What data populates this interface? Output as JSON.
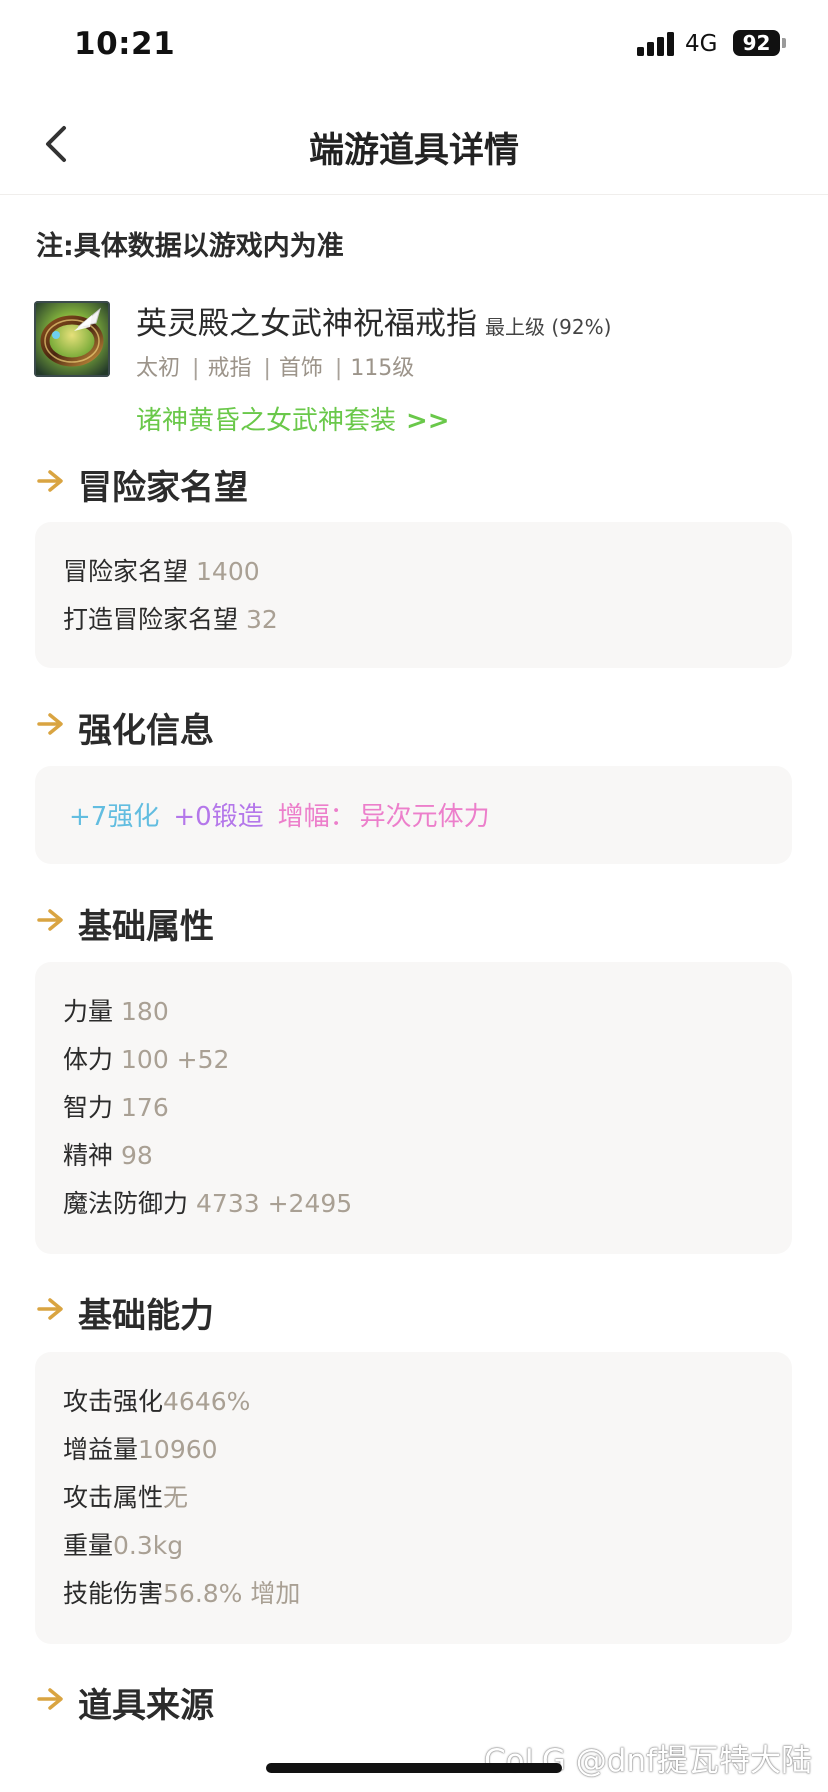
{
  "status_bar": {
    "time": "10:21",
    "network": "4G",
    "battery": "92"
  },
  "nav": {
    "title": "端游道具详情",
    "back_icon": "chevron-left-icon"
  },
  "note": "注:具体数据以游戏内为准",
  "item": {
    "name": "英灵殿之女武神祝福戒指",
    "grade": "最上级 (92%)",
    "rarity": "太初",
    "slot": "戒指",
    "category": "首饰",
    "level": "115级",
    "set_name": "诸神黄昏之女武神套装",
    "set_arrow": ">>",
    "icon": "ring-icon"
  },
  "sections": {
    "fame": {
      "title": "冒险家名望",
      "rows": [
        {
          "label": "冒险家名望",
          "value": "1400"
        },
        {
          "label": "打造冒险家名望",
          "value": "32"
        }
      ]
    },
    "enhance": {
      "title": "强化信息",
      "reinforce": "+7强化",
      "forge": "+0锻造",
      "amplify_label": "增幅：",
      "amplify_value": "异次元体力",
      "colors": {
        "reinforce": "#62bde0",
        "forge": "#b477ea",
        "amplify": "#ec7fcb"
      }
    },
    "base_attrs": {
      "title": "基础属性",
      "rows": [
        {
          "label": "力量",
          "value": "180"
        },
        {
          "label": "体力",
          "value": "100 +52"
        },
        {
          "label": "智力",
          "value": "176"
        },
        {
          "label": "精神",
          "value": "98"
        },
        {
          "label": "魔法防御力",
          "value": "4733 +2495"
        }
      ]
    },
    "base_abilities": {
      "title": "基础能力",
      "rows": [
        {
          "label": "攻击强化",
          "value": "4646%"
        },
        {
          "label": "增益量",
          "value": "10960"
        },
        {
          "label": "攻击属性",
          "value": "无"
        },
        {
          "label": "重量",
          "value": "0.3kg"
        },
        {
          "label": "技能伤害",
          "value": "56.8% 增加"
        }
      ]
    },
    "source": {
      "title": "道具来源"
    }
  },
  "watermark": "CoLG @dnf提瓦特大陆",
  "colors": {
    "accent_gold": "#d9a441",
    "set_green": "#6ac84a",
    "value_gray": "#a9a094",
    "card_bg": "#f8f7f6"
  }
}
